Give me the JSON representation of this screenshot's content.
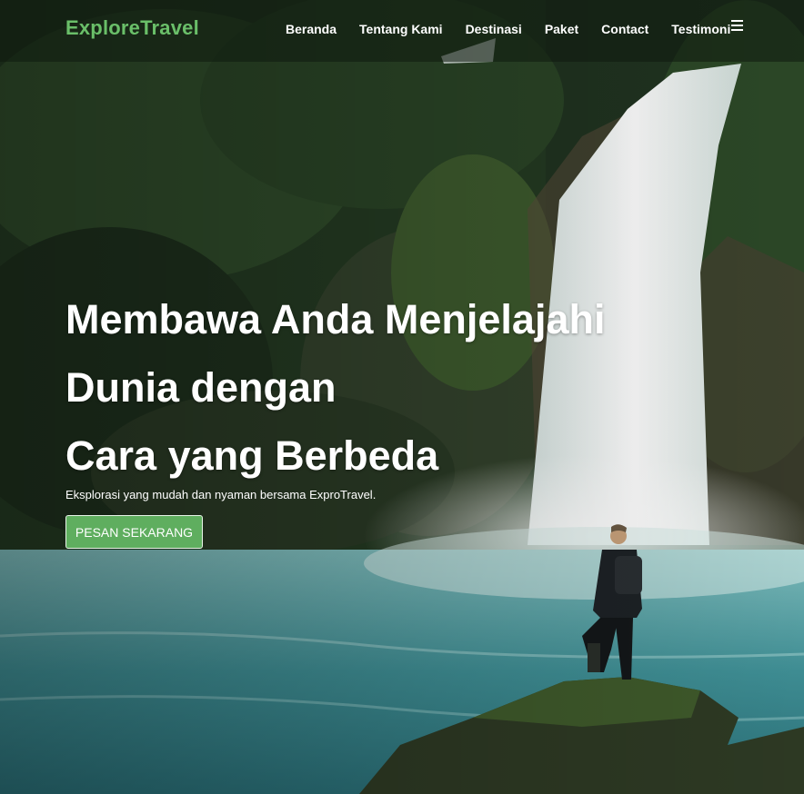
{
  "brand": {
    "name": "ExploreTravel",
    "color": "#6abf69"
  },
  "nav": {
    "items": [
      {
        "label": "Beranda"
      },
      {
        "label": "Tentang Kami"
      },
      {
        "label": "Destinasi"
      },
      {
        "label": "Paket"
      },
      {
        "label": "Contact"
      },
      {
        "label": "Testimoni"
      }
    ],
    "menu_icon": "hamburger-menu-icon"
  },
  "hero": {
    "title_lines": [
      "Membawa Anda Menjelajahi",
      "Dunia dengan",
      "Cara yang Berbeda"
    ],
    "subtitle": "Eksplorasi yang mudah dan nyaman bersama ExproTravel.",
    "cta_label": "PESAN SEKARANG",
    "cta_color": "#5fae5f",
    "background": "waterfall-hiker-photo"
  }
}
